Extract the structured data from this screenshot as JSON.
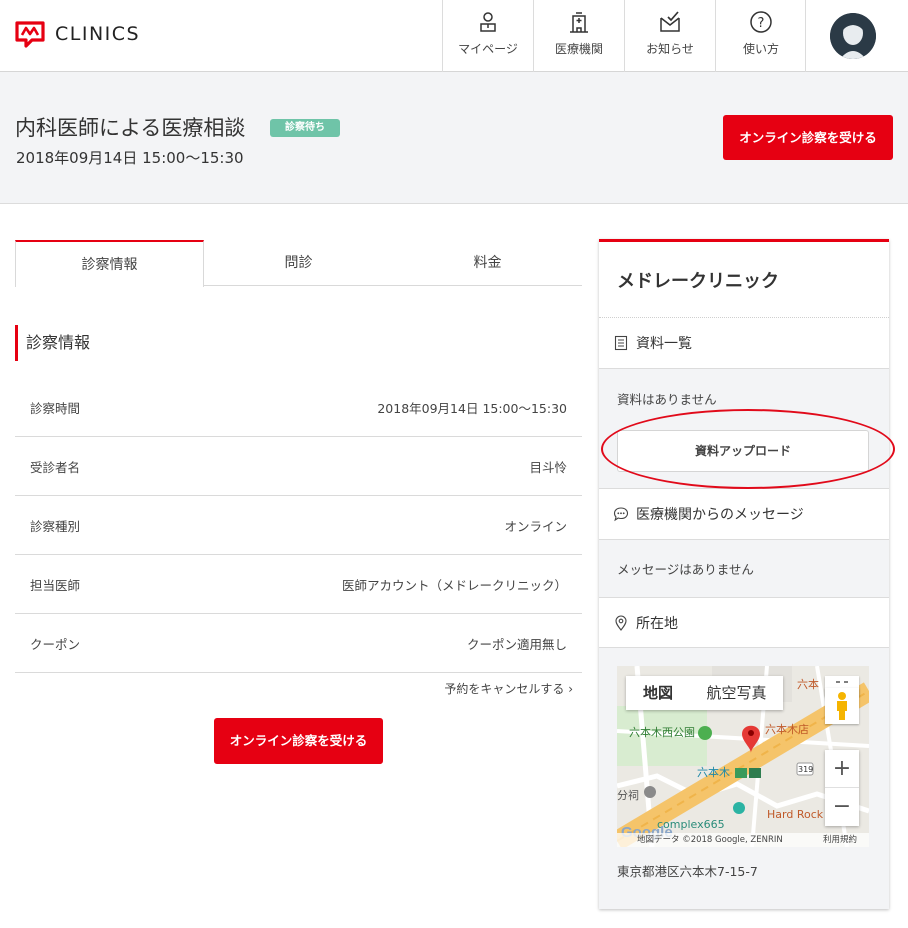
{
  "header": {
    "logo_text": "CLINICS",
    "nav": [
      {
        "label": "マイページ",
        "icon": "mypage-icon"
      },
      {
        "label": "医療機関",
        "icon": "hospital-icon"
      },
      {
        "label": "お知らせ",
        "icon": "notification-icon"
      },
      {
        "label": "使い方",
        "icon": "help-icon"
      }
    ]
  },
  "appointment": {
    "title": "内科医師による医療相談",
    "status": "診察待ち",
    "datetime": "2018年09月14日 15:00〜15:30",
    "cta_label": "オンライン診察を受ける"
  },
  "tabs": [
    "診察情報",
    "問診",
    "料金"
  ],
  "section_title": "診察情報",
  "info_rows": [
    {
      "label": "診察時間",
      "value": "2018年09月14日 15:00〜15:30"
    },
    {
      "label": "受診者名",
      "value": "目斗怜"
    },
    {
      "label": "診察種別",
      "value": "オンライン"
    },
    {
      "label": "担当医師",
      "value": "医師アカウント（メドレークリニック）"
    },
    {
      "label": "クーポン",
      "value": "クーポン適用無し"
    }
  ],
  "cancel_link": "予約をキャンセルする",
  "cta_bottom_label": "オンライン診察を受ける",
  "panel": {
    "clinic_name": "メドレークリニック",
    "documents_title": "資料一覧",
    "documents_empty": "資料はありません",
    "upload_label": "資料アップロード",
    "messages_title": "医療機関からのメッセージ",
    "messages_empty": "メッセージはありません",
    "location_title": "所在地",
    "address": "東京都港区六本木7-15-7",
    "map": {
      "type_map": "地図",
      "type_satellite": "航空写真",
      "zoom_in": "+",
      "zoom_out": "−",
      "copyright": "地図データ ©2018 Google, ZENRIN",
      "terms": "利用規約",
      "google": "Google",
      "labels": {
        "park": "六本木西公園",
        "station": "六本木",
        "store": "六本木店",
        "complex": "complex665",
        "hardrock": "Hard Rock",
        "shrine": "分祠",
        "route": "319",
        "roppongi_top": "六本"
      }
    }
  },
  "colors": {
    "brand": "#e60012",
    "status_badge": "#6fc4a8",
    "band_bg": "#f3f4f6"
  }
}
